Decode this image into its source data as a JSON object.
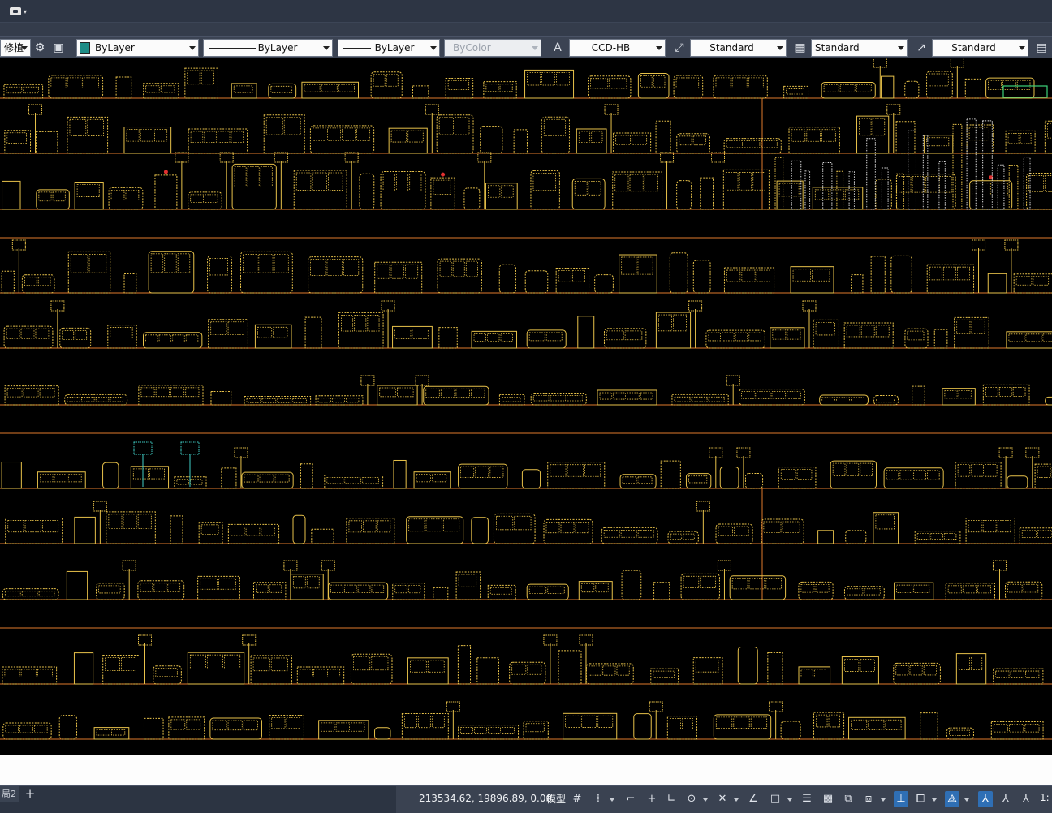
{
  "app": {
    "menu_icon": "cad-app-logo-icon"
  },
  "properties_toolbar": {
    "layer_name": "修植",
    "color": {
      "label": "ByLayer",
      "swatch": "#1d8c86"
    },
    "linetype": {
      "label": "ByLayer"
    },
    "lineweight": {
      "label": "ByLayer"
    },
    "plot_style": {
      "label": "ByColor"
    },
    "text_style": {
      "label": "CCD-HB",
      "icon": "text-style-icon"
    },
    "dim_style": {
      "label": "Standard",
      "icon": "dimension-style-icon"
    },
    "table_style": {
      "label": "Standard",
      "icon": "table-style-icon"
    },
    "multileader_style": {
      "label": "Standard",
      "icon": "multileader-style-icon"
    }
  },
  "drawing": {
    "background": "#000000",
    "divider_color": "#e07a2b",
    "line_color": "#e8c24a",
    "content": "CAD furniture block library: bathroom fixtures, beds, tables, sofas, chairs"
  },
  "status_bar": {
    "layout_tab": "局2",
    "add_tab": "+",
    "coordinates": "213534.62, 19896.89, 0.00",
    "model_label": "模型",
    "scale_label": "1:"
  },
  "colors": {
    "toolbar_bg": "#3b4353",
    "status_bg": "#3a4251",
    "active_toggle": "#2f6fb5"
  }
}
